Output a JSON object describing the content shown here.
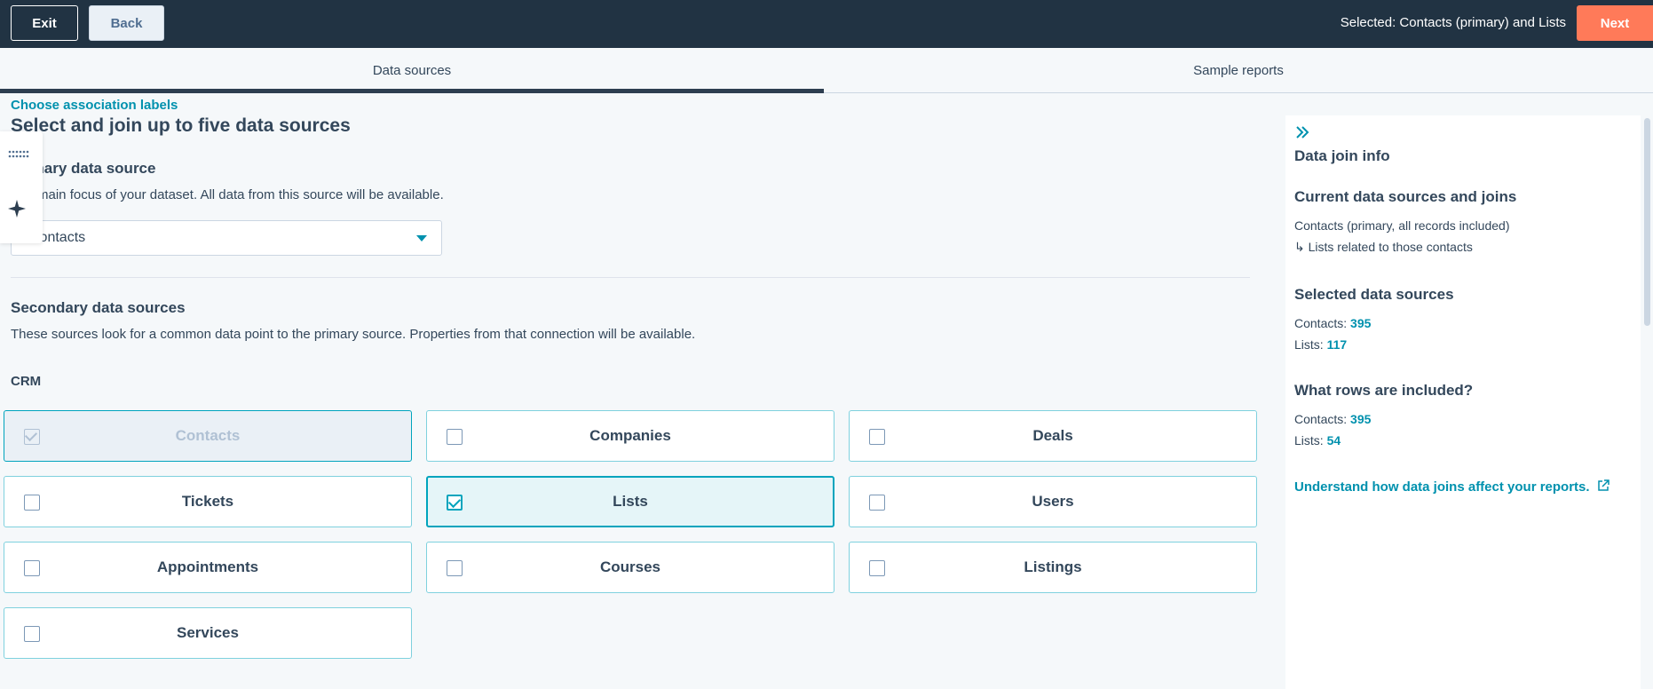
{
  "topbar": {
    "exit_label": "Exit",
    "back_label": "Back",
    "selected_text": "Selected: Contacts (primary) and Lists",
    "next_label": "Next"
  },
  "tabs": [
    {
      "label": "Data sources",
      "active": true
    },
    {
      "label": "Sample reports",
      "active": false
    }
  ],
  "main": {
    "association_link": "Choose association labels",
    "heading": "Select and join up to five data sources",
    "primary_title": "Primary data source",
    "primary_desc": "The main focus of your dataset. All data from this source will be available.",
    "primary_select_value": "Contacts",
    "secondary_title": "Secondary data sources",
    "secondary_desc": "These sources look for a common data point to the primary source. Properties from that connection will be available.",
    "crm_label": "CRM",
    "sources": [
      {
        "label": "Contacts",
        "state": "disabled-checked"
      },
      {
        "label": "Companies",
        "state": "unchecked"
      },
      {
        "label": "Deals",
        "state": "unchecked"
      },
      {
        "label": "Tickets",
        "state": "unchecked"
      },
      {
        "label": "Lists",
        "state": "checked"
      },
      {
        "label": "Users",
        "state": "unchecked"
      },
      {
        "label": "Appointments",
        "state": "unchecked"
      },
      {
        "label": "Courses",
        "state": "unchecked"
      },
      {
        "label": "Listings",
        "state": "unchecked"
      },
      {
        "label": "Services",
        "state": "unchecked"
      }
    ]
  },
  "panel": {
    "title": "Data join info",
    "current_title": "Current data sources and joins",
    "current_line1": "Contacts (primary, all records included)",
    "current_line2": "↳ Lists related to those contacts",
    "selected_title": "Selected data sources",
    "selected_contacts_label": "Contacts:",
    "selected_contacts_value": "395",
    "selected_lists_label": "Lists:",
    "selected_lists_value": "117",
    "rows_title": "What rows are included?",
    "rows_contacts_label": "Contacts:",
    "rows_contacts_value": "395",
    "rows_lists_label": "Lists:",
    "rows_lists_value": "54",
    "help_link": "Understand how data joins affect your reports."
  },
  "icons": {
    "collapse": "double-chevron-right-icon",
    "dots": "grip-dots-icon",
    "sparkle": "sparkle-icon",
    "external": "external-link-icon"
  },
  "colors": {
    "topbar": "#213343",
    "accent": "#0091ae",
    "next_button": "#ff7a59"
  }
}
